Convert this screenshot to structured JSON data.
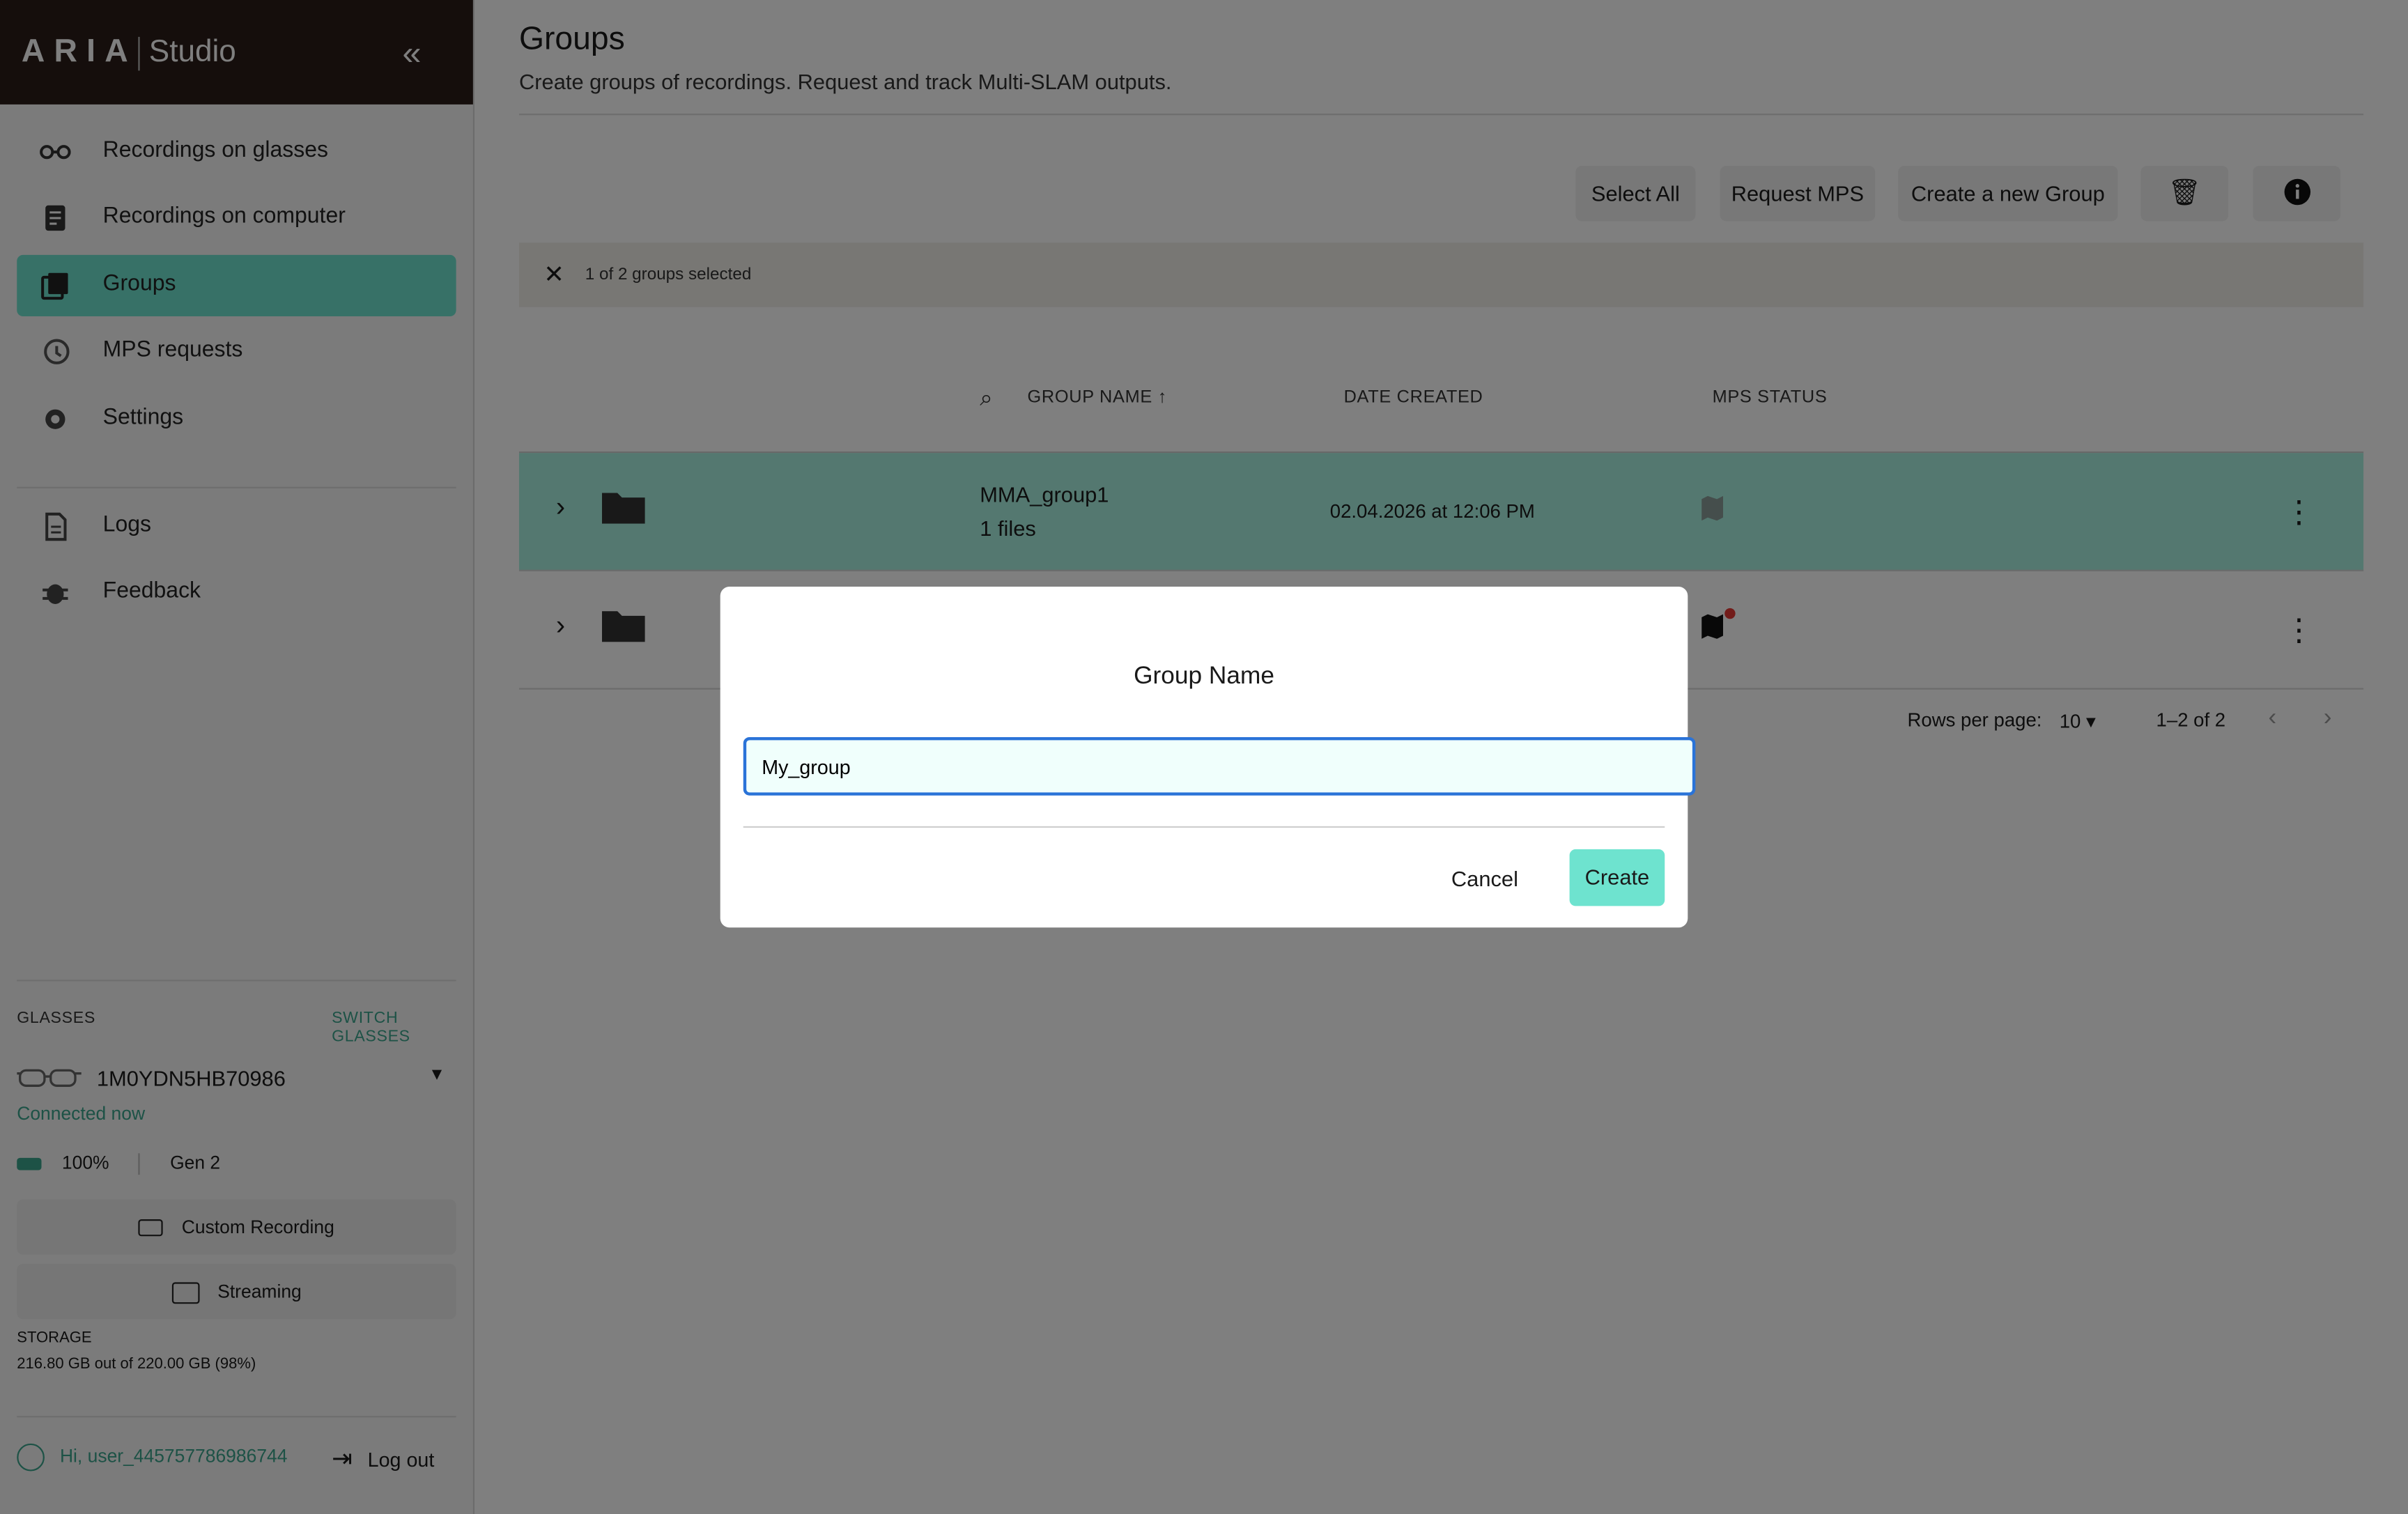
{
  "brand": {
    "logo": "ARIA",
    "product": "Studio"
  },
  "sidebar": {
    "items": [
      {
        "label": "Recordings on glasses",
        "icon": "glasses-icon"
      },
      {
        "label": "Recordings on computer",
        "icon": "document-icon"
      },
      {
        "label": "Groups",
        "icon": "groups-icon",
        "active": true
      },
      {
        "label": "MPS requests",
        "icon": "history-icon"
      },
      {
        "label": "Settings",
        "icon": "gear-icon"
      },
      {
        "label": "Logs",
        "icon": "log-file-icon"
      },
      {
        "label": "Feedback",
        "icon": "bug-icon"
      }
    ],
    "glasses_label": "GLASSES",
    "switch_label": "SWITCH GLASSES",
    "serial": "1M0YDN5HB70986",
    "status": "Connected now",
    "battery": "100%",
    "generation": "Gen 2",
    "custom_recording": "Custom Recording",
    "streaming": "Streaming",
    "storage_label": "STORAGE",
    "storage_value": "216.80 GB out of 220.00 GB (98%)",
    "user": "Hi, user_445757786986744",
    "logout": "Log out"
  },
  "page": {
    "title": "Groups",
    "subtitle": "Create groups of recordings. Request and track Multi-SLAM outputs.",
    "toolbar": {
      "select_all": "Select All",
      "request_mps": "Request MPS",
      "create_group": "Create a new Group"
    },
    "selection_text": "1 of 2 groups selected",
    "columns": {
      "name": "GROUP NAME",
      "date": "DATE CREATED",
      "mps": "MPS STATUS"
    },
    "rows": [
      {
        "name": "MMA_group1",
        "files": "1 files",
        "date": "02.04.2026 at 12:06 PM"
      }
    ],
    "pager": {
      "rows_label": "Rows per page:",
      "rows_value": "10",
      "range": "1–2 of 2"
    }
  },
  "dialog": {
    "title": "Group Name",
    "input_value": "My_group",
    "cancel": "Cancel",
    "create": "Create"
  },
  "colors": {
    "accent": "#6ee3cf",
    "brand_bg": "#2b1d18",
    "link_green": "#3aa48c",
    "focus_blue": "#2a73d8",
    "alert_red": "#e53935"
  }
}
